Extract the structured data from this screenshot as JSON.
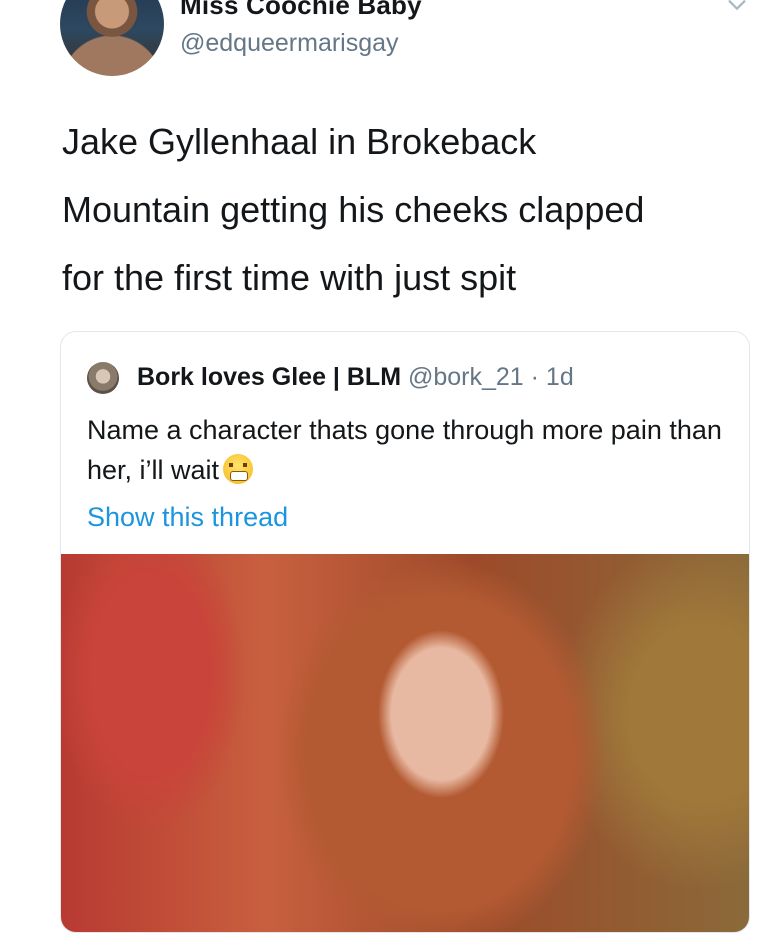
{
  "author": {
    "display_name": "Miss Coochie Baby",
    "handle": "@edqueermarisgay",
    "avatar_icon": "profile-photo-avatar"
  },
  "tweet": {
    "lines": [
      "Jake Gyllenhaal in Brokeback",
      "Mountain getting his cheeks clapped",
      "for the first time with just spit"
    ]
  },
  "quoted_tweet": {
    "display_name": "Bork loves Glee | BLM",
    "handle": "@bork_21",
    "separator": " · ",
    "time": "1d",
    "text": "Name a character thats gone through more pain than her, i’ll wait",
    "emoji": "persevering-face-emoji",
    "show_thread": "Show this thread",
    "media": "photo-crying-woman"
  },
  "colors": {
    "text": "#14171a",
    "secondary": "#657786",
    "link": "#1b95e0",
    "border": "#e1e8ed"
  }
}
